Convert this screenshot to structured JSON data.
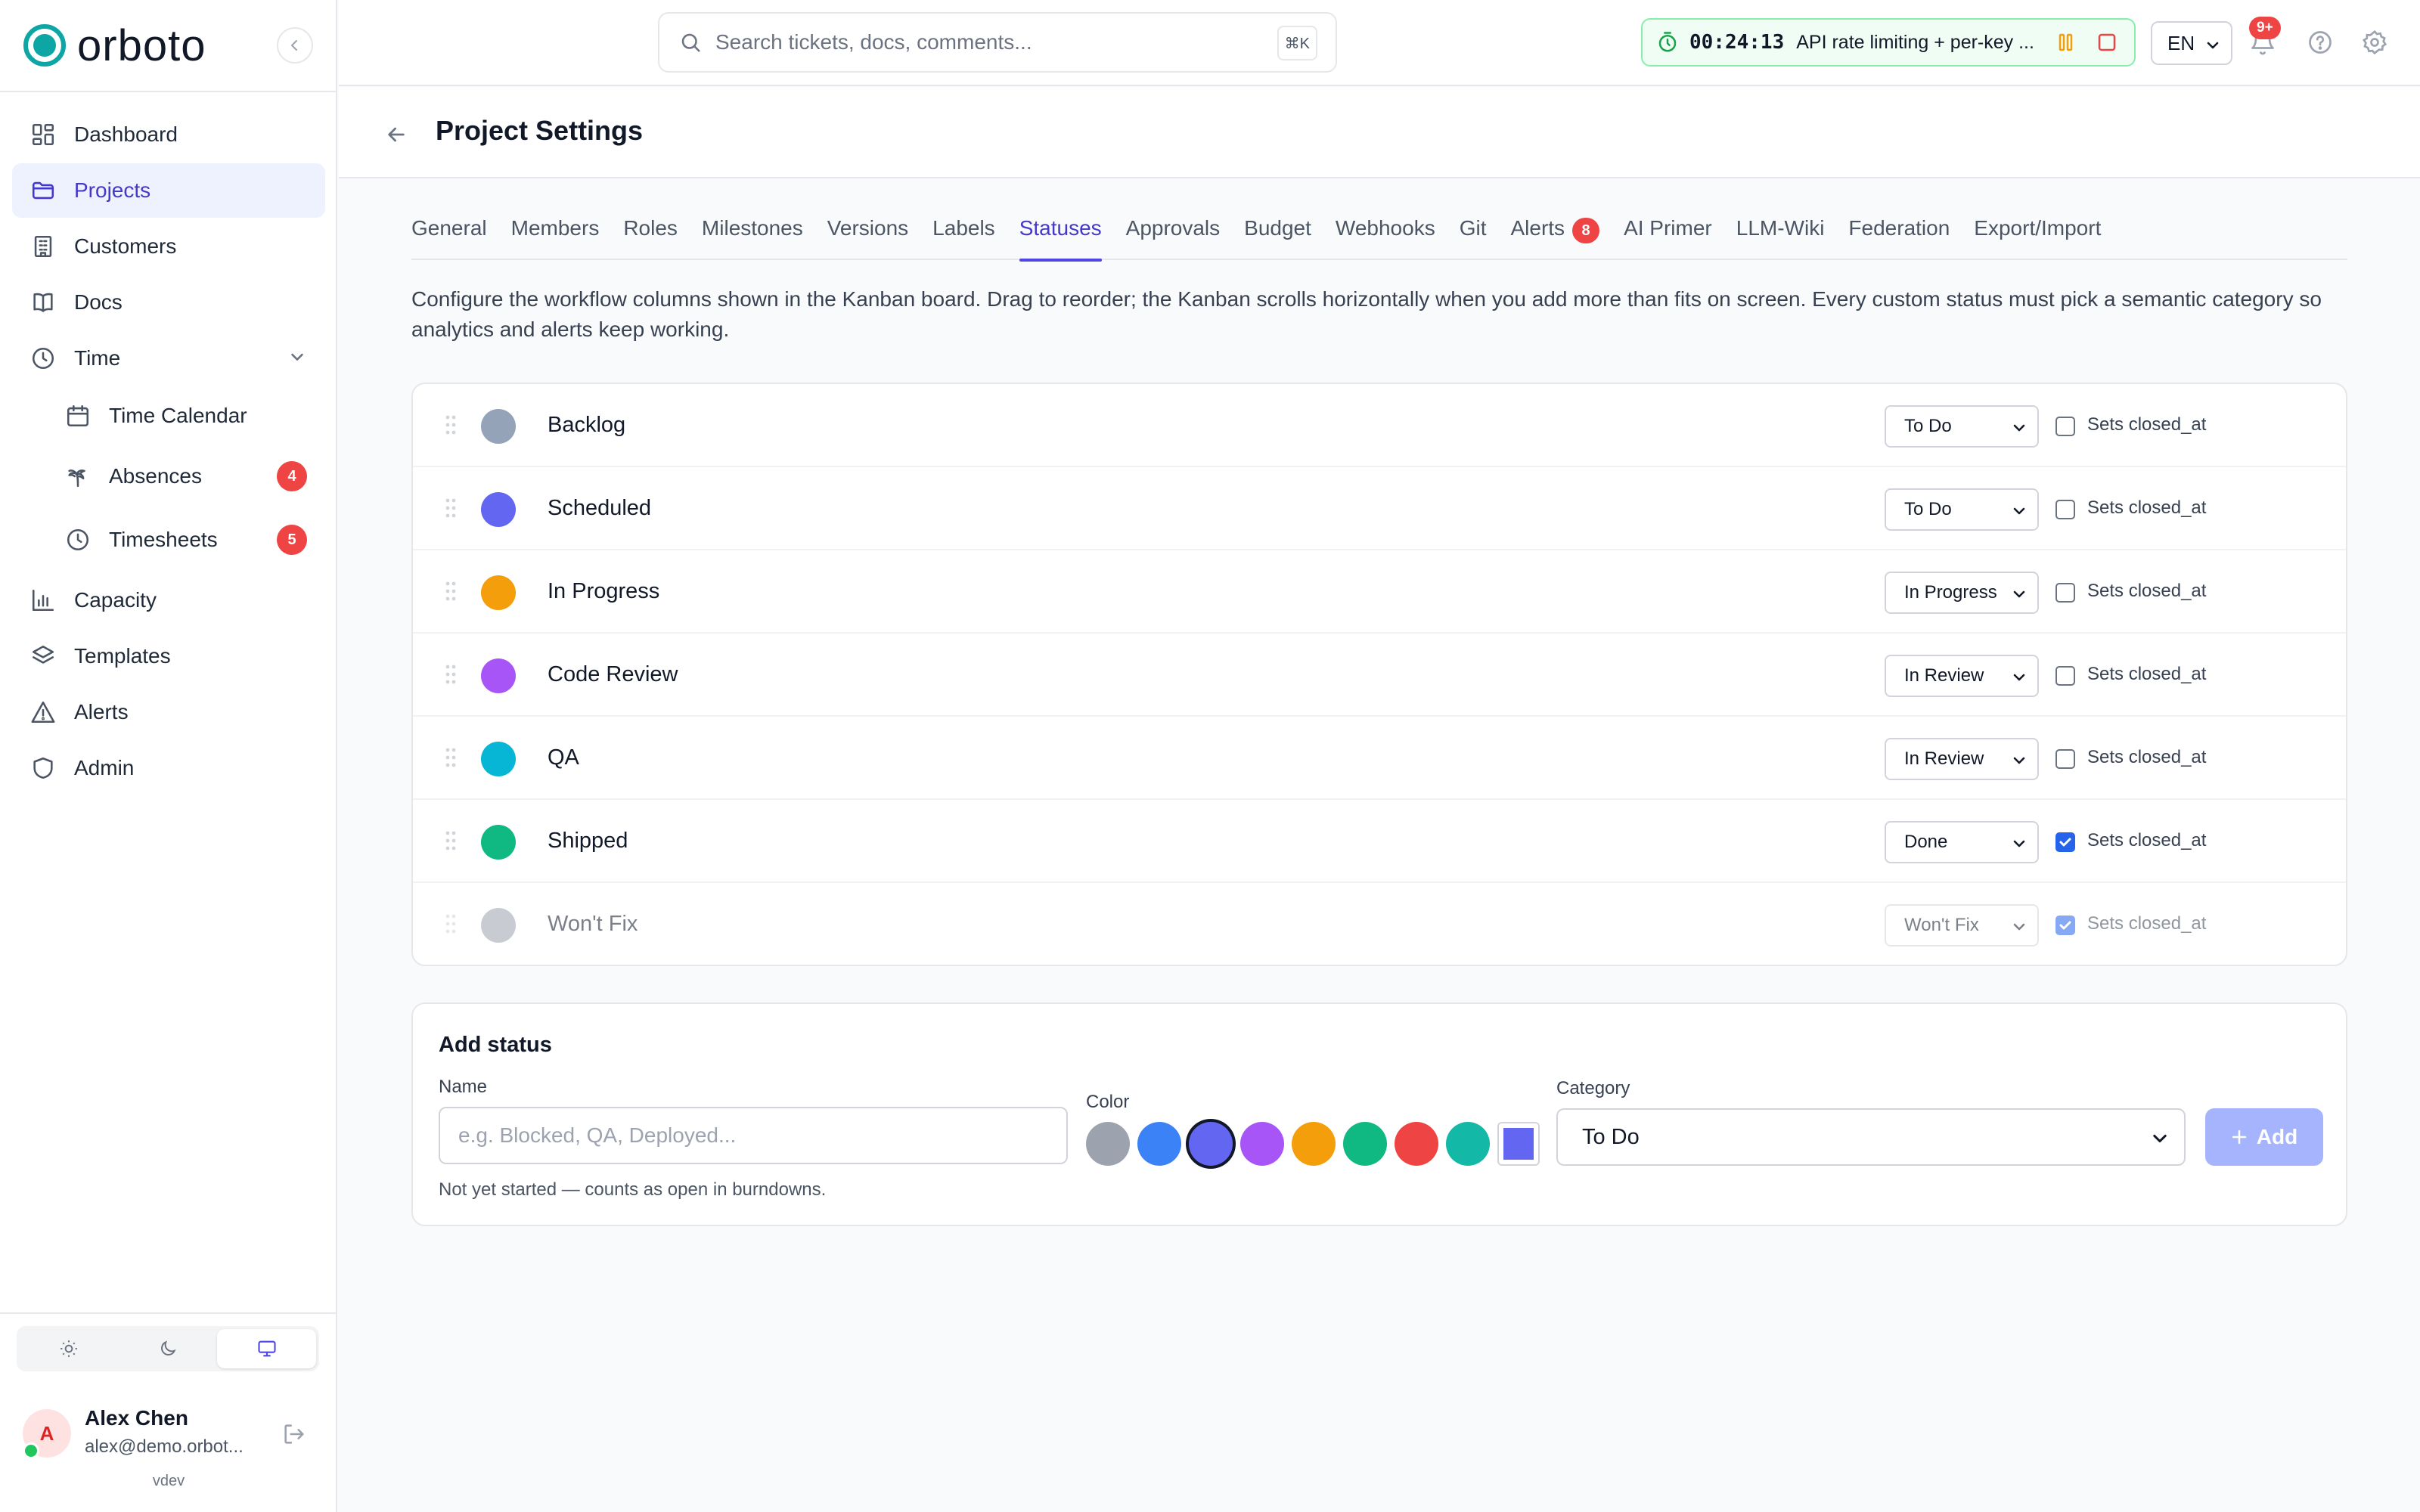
{
  "app": {
    "name": "orboto",
    "accent": "#4f46e5",
    "brand_color": "#0ea5a5"
  },
  "sidebar": {
    "items": [
      {
        "label": "Dashboard",
        "icon": "dashboard-icon"
      },
      {
        "label": "Projects",
        "icon": "folder-icon",
        "active": true
      },
      {
        "label": "Customers",
        "icon": "building-icon"
      },
      {
        "label": "Docs",
        "icon": "book-icon"
      },
      {
        "label": "Time",
        "icon": "clock-icon",
        "expanded": true
      },
      {
        "label": "Time Calendar",
        "icon": "calendar-icon",
        "sub": true
      },
      {
        "label": "Absences",
        "icon": "palm-tree-icon",
        "sub": true,
        "badge": "4"
      },
      {
        "label": "Timesheets",
        "icon": "clock-icon",
        "sub": true,
        "badge": "5"
      },
      {
        "label": "Capacity",
        "icon": "bar-chart-icon"
      },
      {
        "label": "Templates",
        "icon": "layers-icon"
      },
      {
        "label": "Alerts",
        "icon": "alert-triangle-icon"
      },
      {
        "label": "Admin",
        "icon": "shield-icon"
      }
    ],
    "theme_options": [
      "sun-icon",
      "moon-icon",
      "monitor-icon"
    ],
    "theme_selected": "monitor-icon",
    "user": {
      "initial": "A",
      "name": "Alex Chen",
      "email": "alex@demo.orbot..."
    },
    "version": "vdev"
  },
  "topbar": {
    "search_placeholder": "Search tickets, docs, comments...",
    "search_shortcut": "⌘K",
    "timer": {
      "time": "00:24:13",
      "task": "API rate limiting + per-key ..."
    },
    "language": "EN",
    "notifications_badge": "9+"
  },
  "page": {
    "title": "Project Settings"
  },
  "tabs": [
    {
      "label": "General"
    },
    {
      "label": "Members"
    },
    {
      "label": "Roles"
    },
    {
      "label": "Milestones"
    },
    {
      "label": "Versions"
    },
    {
      "label": "Labels"
    },
    {
      "label": "Statuses",
      "active": true
    },
    {
      "label": "Approvals"
    },
    {
      "label": "Budget"
    },
    {
      "label": "Webhooks"
    },
    {
      "label": "Git"
    },
    {
      "label": "Alerts",
      "badge": "8"
    },
    {
      "label": "AI Primer"
    },
    {
      "label": "LLM-Wiki"
    },
    {
      "label": "Federation"
    },
    {
      "label": "Export/Import"
    }
  ],
  "description": "Configure the workflow columns shown in the Kanban board. Drag to reorder; the Kanban scrolls horizontally when you add more than fits on screen. Every custom status must pick a semantic category so analytics and alerts keep working.",
  "statuses": [
    {
      "name": "Backlog",
      "color": "#94a3b8",
      "category": "To Do",
      "sets_closed_at": false,
      "hidden": false
    },
    {
      "name": "Scheduled",
      "color": "#6366f1",
      "category": "To Do",
      "sets_closed_at": false,
      "hidden": false
    },
    {
      "name": "In Progress",
      "color": "#f59e0b",
      "category": "In Progress",
      "sets_closed_at": false,
      "hidden": false
    },
    {
      "name": "Code Review",
      "color": "#a855f7",
      "category": "In Review",
      "sets_closed_at": false,
      "hidden": false
    },
    {
      "name": "QA",
      "color": "#06b6d4",
      "category": "In Review",
      "sets_closed_at": false,
      "hidden": false
    },
    {
      "name": "Shipped",
      "color": "#10b981",
      "category": "Done",
      "sets_closed_at": true,
      "hidden": false
    },
    {
      "name": "Won't Fix",
      "color": "#9ca3af",
      "category": "Won't Fix",
      "sets_closed_at": true,
      "hidden": true
    }
  ],
  "sets_closed_label": "Sets closed_at",
  "add_status": {
    "title": "Add status",
    "name_label": "Name",
    "name_placeholder": "e.g. Blocked, QA, Deployed...",
    "color_label": "Color",
    "colors": [
      "#9ca3af",
      "#3b82f6",
      "#6366f1",
      "#a855f7",
      "#f59e0b",
      "#10b981",
      "#ef4444",
      "#14b8a6"
    ],
    "selected_color": "#6366f1",
    "custom_color": "#6366f1",
    "category_label": "Category",
    "category_value": "To Do",
    "add_label": "Add",
    "hint": "Not yet started — counts as open in burndowns."
  }
}
